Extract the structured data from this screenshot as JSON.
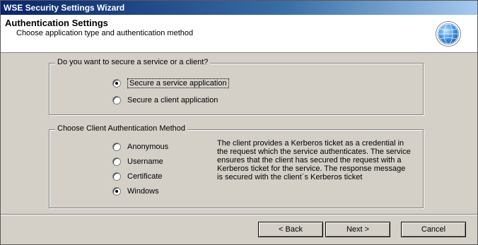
{
  "window": {
    "title": "WSE Security Settings Wizard"
  },
  "header": {
    "title": "Authentication Settings",
    "subtitle": "Choose application type and authentication method",
    "icon": "globe-icon"
  },
  "secure_group": {
    "legend": "Do you want to secure a service or a client?",
    "options": [
      {
        "label": "Secure a service application",
        "checked": true
      },
      {
        "label": "Secure a client application",
        "checked": false
      }
    ]
  },
  "auth_group": {
    "legend": "Choose Client Authentication Method",
    "options": [
      {
        "label": "Anonymous",
        "checked": false
      },
      {
        "label": "Username",
        "checked": false
      },
      {
        "label": "Certificate",
        "checked": false
      },
      {
        "label": "Windows",
        "checked": true
      }
    ],
    "description": "The client provides a Kerberos ticket as a credential in the request which the service authenticates. The service ensures that the client has secured the request with a Kerberos ticket for the service. The response message is secured with the client´s Kerberos ticket"
  },
  "buttons": {
    "back": "< Back",
    "next": "Next >",
    "cancel": "Cancel"
  }
}
